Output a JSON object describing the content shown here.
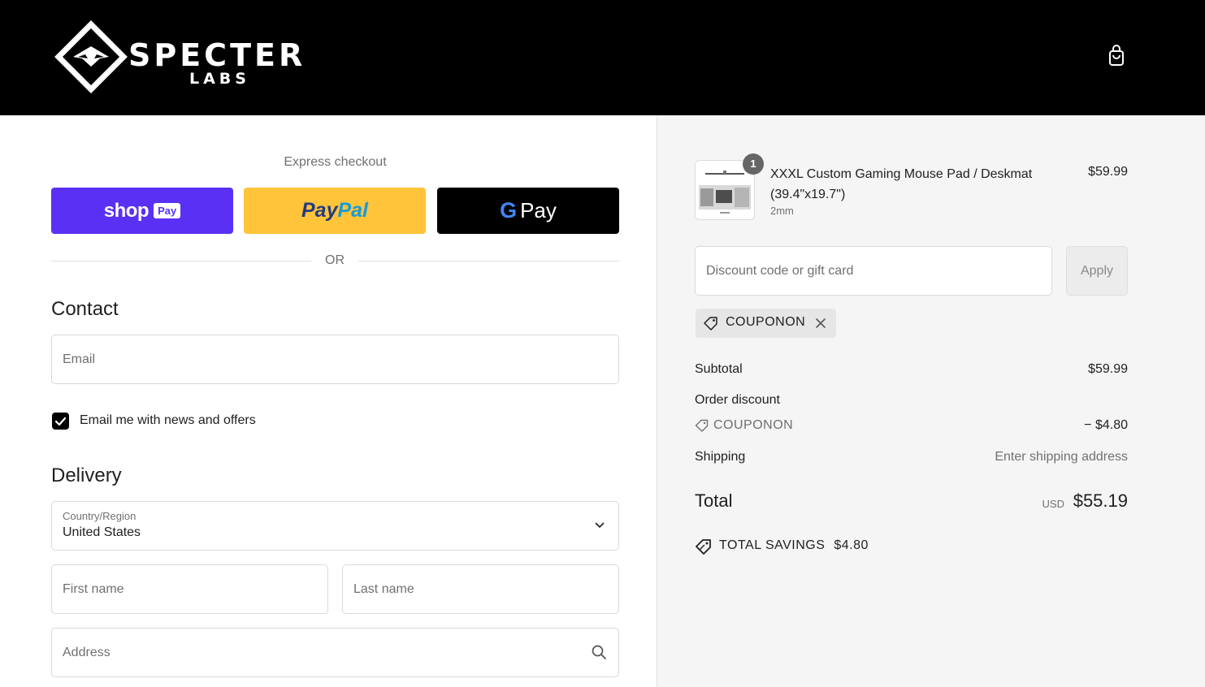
{
  "brand": {
    "name": "SPECTER",
    "subtitle": "LABS"
  },
  "header": {
    "cart_icon": "shopping-bag-icon"
  },
  "express_checkout": {
    "label": "Express checkout",
    "shop_pay": {
      "brand": "shop",
      "badge": "Pay",
      "color": "#5a31f4"
    },
    "paypal": {
      "part1": "Pay",
      "part2": "Pal",
      "color": "#ffc439"
    },
    "google_pay": {
      "g": "G",
      "label": "Pay",
      "color": "#000000"
    },
    "divider": "OR"
  },
  "contact": {
    "title": "Contact",
    "email_placeholder": "Email",
    "newsletter_label": "Email me with news and offers",
    "newsletter_checked": true
  },
  "delivery": {
    "title": "Delivery",
    "country_label": "Country/Region",
    "country_value": "United States",
    "first_name_placeholder": "First name",
    "last_name_placeholder": "Last name",
    "address_placeholder": "Address"
  },
  "order": {
    "product": {
      "name": "XXXL Custom Gaming Mouse Pad / Deskmat (39.4\"x19.7\")",
      "variant": "2mm",
      "price": "$59.99",
      "quantity": "1"
    },
    "discount": {
      "placeholder": "Discount code or gift card",
      "apply_label": "Apply",
      "applied_code": "COUPONON"
    },
    "summary": {
      "subtotal_label": "Subtotal",
      "subtotal_value": "$59.99",
      "order_discount_label": "Order discount",
      "discount_code": "COUPONON",
      "discount_value": "− $4.80",
      "shipping_label": "Shipping",
      "shipping_value": "Enter shipping address",
      "total_label": "Total",
      "currency": "USD",
      "total_value": "$55.19",
      "savings_label": "TOTAL SAVINGS",
      "savings_value": "$4.80"
    }
  }
}
